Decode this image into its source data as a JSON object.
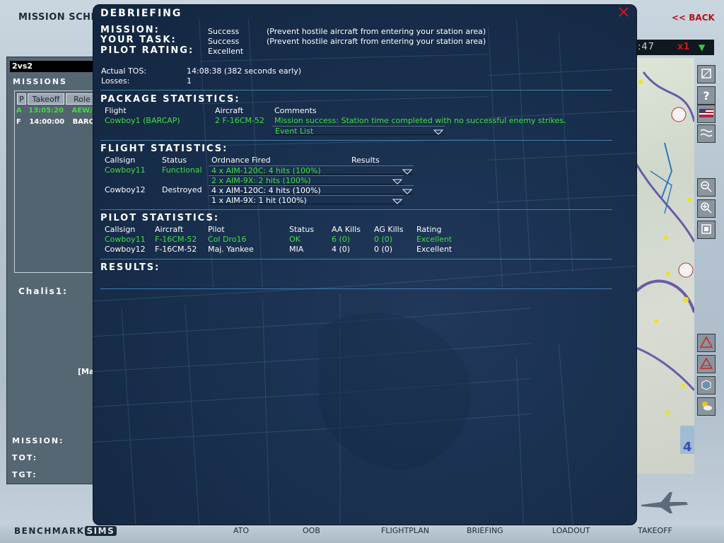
{
  "background": {
    "title": "MISSION SCHEDU",
    "back_label": "<< BACK",
    "package_name": "2vs2",
    "missions_label": "MISSIONS",
    "mission_list_headers": [
      "P",
      "Takeoff",
      "Role"
    ],
    "mission_rows": [
      {
        "p": "A",
        "takeoff": "13:05:20",
        "role": "AEW/AE",
        "color": "#3ee03e"
      },
      {
        "p": "F",
        "takeoff": "14:00:00",
        "role": "BARCAP",
        "color": "#ffffff"
      }
    ],
    "flight_label": "Chalis1:",
    "ma_label": "[Ma",
    "mission_label": "MISSION:",
    "tot_label": "TOT:",
    "tgt_label": "TGT:",
    "clock": ":47",
    "time_compression": "x1",
    "logo_text": "BENCHMARK",
    "logo_badge": "SIMS",
    "nav": [
      "ATO",
      "OOB",
      "FLIGHTPLAN",
      "BRIEFING",
      "LOADOUT",
      "TAKEOFF"
    ]
  },
  "debrief": {
    "title": "Debriefing",
    "mission_label": "Mission:",
    "mission_value": "Success",
    "mission_note": "(Prevent hostile aircraft from entering your station area)",
    "task_label": "Your Task:",
    "task_value": "Success",
    "task_note": "(Prevent hostile aircraft from entering your station area)",
    "rating_label": "Pilot Rating:",
    "rating_value": "Excellent",
    "tos_label": "Actual TOS:",
    "tos_value": "14:08:38 (382 seconds early)",
    "losses_label": "Losses:",
    "losses_value": "1",
    "package_section": "Package Statistics:",
    "package_headers": [
      "Flight",
      "Aircraft",
      "Comments"
    ],
    "package_row": {
      "flight": "Cowboy1 (BARCAP)",
      "aircraft": "2 F-16CM-52",
      "comment": "Mission success: Station time completed with no successful enemy strikes."
    },
    "event_list": "Event List",
    "flight_section": "Flight Statistics:",
    "flight_headers": [
      "Callsign",
      "Status",
      "Ordnance Fired",
      "Results"
    ],
    "flight_rows": [
      {
        "callsign": "Cowboy11",
        "status": "Functional",
        "ord1": "4 x AIM-120C: 4 hits (100%)",
        "ord2": "2 x AIM-9X: 2 hits (100%)",
        "color": "#3ee03e"
      },
      {
        "callsign": "Cowboy12",
        "status": "Destroyed",
        "ord1": "4 x AIM-120C: 4 hits (100%)",
        "ord2": "1 x AIM-9X: 1 hit (100%)",
        "color": "#ffffff"
      }
    ],
    "pilot_section": "Pilot Statistics:",
    "pilot_headers": [
      "Callsign",
      "Aircraft",
      "Pilot",
      "Status",
      "AA Kills",
      "AG Kills",
      "Rating"
    ],
    "pilot_rows": [
      {
        "callsign": "Cowboy11",
        "aircraft": "F-16CM-52",
        "pilot": "Col Dro16",
        "status": "OK",
        "aa": "6 (0)",
        "ag": "0 (0)",
        "rating": "Excellent",
        "color": "#3ee03e"
      },
      {
        "callsign": "Cowboy12",
        "aircraft": "F-16CM-52",
        "pilot": "Maj. Yankee",
        "status": "MIA",
        "aa": "4 (0)",
        "ag": "0 (0)",
        "rating": "Excellent",
        "color": "#ffffff"
      }
    ],
    "results_section": "Results:"
  },
  "colors": {
    "accent_green": "#3ee03e",
    "close_red": "#d3121b",
    "divider_blue": "#3f7fa8",
    "dialog_bg": "#19304f"
  }
}
